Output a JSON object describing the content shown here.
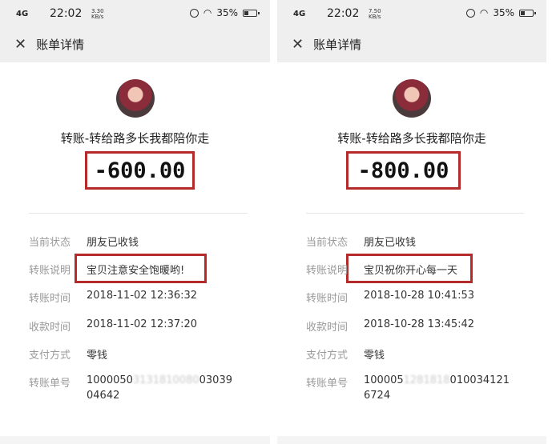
{
  "panels": [
    {
      "status": {
        "signal": "4G",
        "time": "22:02",
        "speed_val": "3.30",
        "speed_unit": "KB/s",
        "battery": "35%",
        "battery_level": 0.35
      },
      "nav": {
        "title": "账单详情"
      },
      "transfer_name": "转账-转给路多长我都陪你走",
      "amount": "-600.00",
      "details": [
        {
          "label": "当前状态",
          "value": "朋友已收钱"
        },
        {
          "label": "转账说明",
          "value": "宝贝注意安全饱暖哟!"
        },
        {
          "label": "转账时间",
          "value": "2018-11-02 12:36:32"
        },
        {
          "label": "收款时间",
          "value": "2018-11-02 12:37:20"
        },
        {
          "label": "支付方式",
          "value": "零钱"
        },
        {
          "label": "转账单号",
          "value": "1000050",
          "value_line2": "04642",
          "value_tail": "03039"
        }
      ]
    },
    {
      "status": {
        "signal": "4G",
        "time": "22:02",
        "speed_val": "7.50",
        "speed_unit": "KB/s",
        "battery": "35%",
        "battery_level": 0.35
      },
      "nav": {
        "title": "账单详情"
      },
      "transfer_name": "转账-转给路多长我都陪你走",
      "amount": "-800.00",
      "details": [
        {
          "label": "当前状态",
          "value": "朋友已收钱"
        },
        {
          "label": "转账说明",
          "value": "宝贝祝你开心每一天"
        },
        {
          "label": "转账时间",
          "value": "2018-10-28 10:41:53"
        },
        {
          "label": "收款时间",
          "value": "2018-10-28 13:45:42"
        },
        {
          "label": "支付方式",
          "value": "零钱"
        },
        {
          "label": "转账单号",
          "value": "100005",
          "value_line2": "6724",
          "value_tail": "010034121"
        }
      ]
    }
  ],
  "colors": {
    "highlight": "#b52a2a",
    "label": "#9a9a9a",
    "topbar": "#efefef"
  },
  "icons": [
    "close-icon",
    "alarm-icon",
    "wifi-icon",
    "battery-icon",
    "signal-icon"
  ]
}
